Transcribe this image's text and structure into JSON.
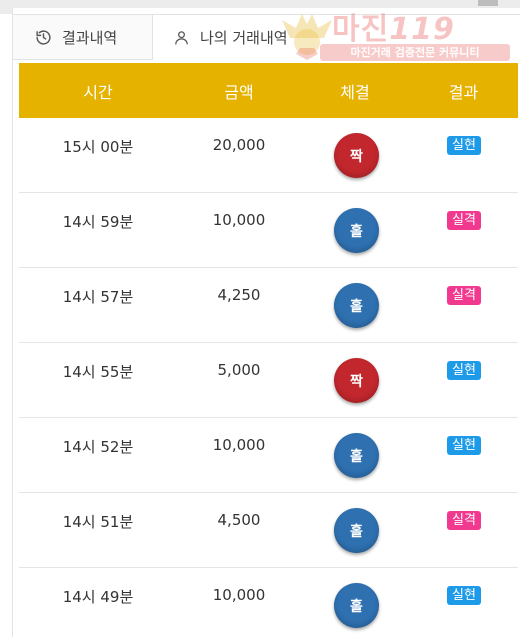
{
  "tabs": {
    "results_label": "결과내역",
    "mine_label": "나의 거래내역"
  },
  "watermark": {
    "brand": "마진",
    "number": "119",
    "subtitle": "마진거래 검증전문 커뮤니티"
  },
  "table": {
    "headers": [
      "시간",
      "금액",
      "체결",
      "결과"
    ],
    "rows": [
      {
        "time": "15시 00분",
        "amount": "20,000",
        "fill": "짝",
        "fill_color": "#c1272d",
        "result": "실현",
        "result_color": "#1e9be8"
      },
      {
        "time": "14시 59분",
        "amount": "10,000",
        "fill": "홀",
        "fill_color": "#2e70b0",
        "result": "실격",
        "result_color": "#f0398f"
      },
      {
        "time": "14시 57분",
        "amount": "4,250",
        "fill": "홀",
        "fill_color": "#2e70b0",
        "result": "실격",
        "result_color": "#f0398f"
      },
      {
        "time": "14시 55분",
        "amount": "5,000",
        "fill": "짝",
        "fill_color": "#c1272d",
        "result": "실현",
        "result_color": "#1e9be8"
      },
      {
        "time": "14시 52분",
        "amount": "10,000",
        "fill": "홀",
        "fill_color": "#2e70b0",
        "result": "실현",
        "result_color": "#1e9be8"
      },
      {
        "time": "14시 51분",
        "amount": "4,500",
        "fill": "홀",
        "fill_color": "#2e70b0",
        "result": "실격",
        "result_color": "#f0398f"
      },
      {
        "time": "14시 49분",
        "amount": "10,000",
        "fill": "홀",
        "fill_color": "#2e70b0",
        "result": "실현",
        "result_color": "#1e9be8"
      }
    ]
  },
  "colors": {
    "header_bg": "#e6b200",
    "even_ball": "#c1272d",
    "odd_ball": "#2e70b0",
    "badge_realized": "#1e9be8",
    "badge_failed": "#f0398f"
  },
  "icons": {
    "results_tab_icon": "history-icon",
    "mine_tab_icon": "user-icon"
  }
}
